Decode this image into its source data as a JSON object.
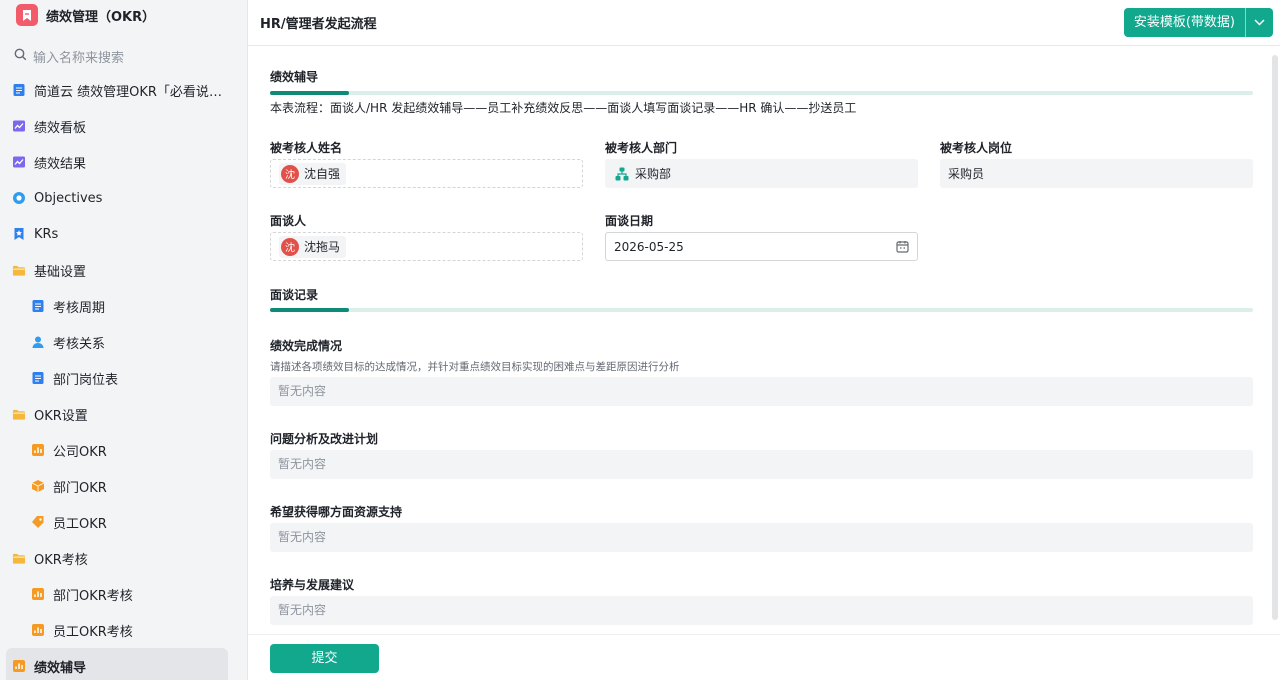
{
  "app": {
    "title": "绩效管理（OKR）",
    "brand_color": "#f25c6a",
    "accent_color": "#11a88e"
  },
  "sidebar": {
    "search_placeholder": "输入名称来搜索",
    "items": [
      {
        "label": "简道云 绩效管理OKR「必看说明…",
        "icon": "form-doc-icon",
        "level": 0
      },
      {
        "label": "绩效看板",
        "icon": "dashboard-chart-icon",
        "level": 0
      },
      {
        "label": "绩效结果",
        "icon": "dashboard-chart-icon",
        "level": 0
      },
      {
        "label": "Objectives",
        "icon": "objective-circle-icon",
        "level": 0
      },
      {
        "label": "KRs",
        "icon": "kr-bookmark-icon",
        "level": 0
      },
      {
        "label": "基础设置",
        "icon": "folder-icon",
        "level": 0
      },
      {
        "label": "考核周期",
        "icon": "form-doc-icon",
        "level": 1
      },
      {
        "label": "考核关系",
        "icon": "user-icon",
        "level": 1
      },
      {
        "label": "部门岗位表",
        "icon": "form-doc-icon",
        "level": 1
      },
      {
        "label": "OKR设置",
        "icon": "folder-icon",
        "level": 0
      },
      {
        "label": "公司OKR",
        "icon": "report-bar-icon",
        "level": 1
      },
      {
        "label": "部门OKR",
        "icon": "box-icon",
        "level": 1
      },
      {
        "label": "员工OKR",
        "icon": "tag-icon",
        "level": 1
      },
      {
        "label": "OKR考核",
        "icon": "folder-icon",
        "level": 0
      },
      {
        "label": "部门OKR考核",
        "icon": "report-bar-icon",
        "level": 1
      },
      {
        "label": "员工OKR考核",
        "icon": "report-bar-icon",
        "level": 1
      },
      {
        "label": "绩效辅导",
        "icon": "report-bar-icon",
        "level": 0,
        "active": true
      }
    ]
  },
  "header": {
    "title": "HR/管理者发起流程",
    "install_button": "安装模板(带数据)"
  },
  "form": {
    "section1": {
      "title": "绩效辅导",
      "description": "本表流程：面谈人/HR 发起绩效辅导——员工补充绩效反思——面谈人填写面谈记录——HR 确认——抄送员工"
    },
    "fields": {
      "assessee_name": {
        "label": "被考核人姓名",
        "value": "沈自强",
        "avatar": "沈"
      },
      "assessee_dept": {
        "label": "被考核人部门",
        "value": "采购部"
      },
      "assessee_post": {
        "label": "被考核人岗位",
        "value": "采购员"
      },
      "interviewer": {
        "label": "面谈人",
        "value": "沈拖马",
        "avatar": "沈"
      },
      "interview_date": {
        "label": "面谈日期",
        "value": "2026-05-25"
      }
    },
    "section2": {
      "title": "面谈记录"
    },
    "records": {
      "completion": {
        "label": "绩效完成情况",
        "hint": "请描述各项绩效目标的达成情况，并针对重点绩效目标实现的困难点与差距原因进行分析",
        "placeholder": "暂无内容"
      },
      "analysis": {
        "label": "问题分析及改进计划",
        "placeholder": "暂无内容"
      },
      "support": {
        "label": "希望获得哪方面资源支持",
        "placeholder": "暂无内容"
      },
      "development": {
        "label": "培养与发展建议",
        "placeholder": "暂无内容"
      }
    },
    "submit_label": "提交"
  }
}
